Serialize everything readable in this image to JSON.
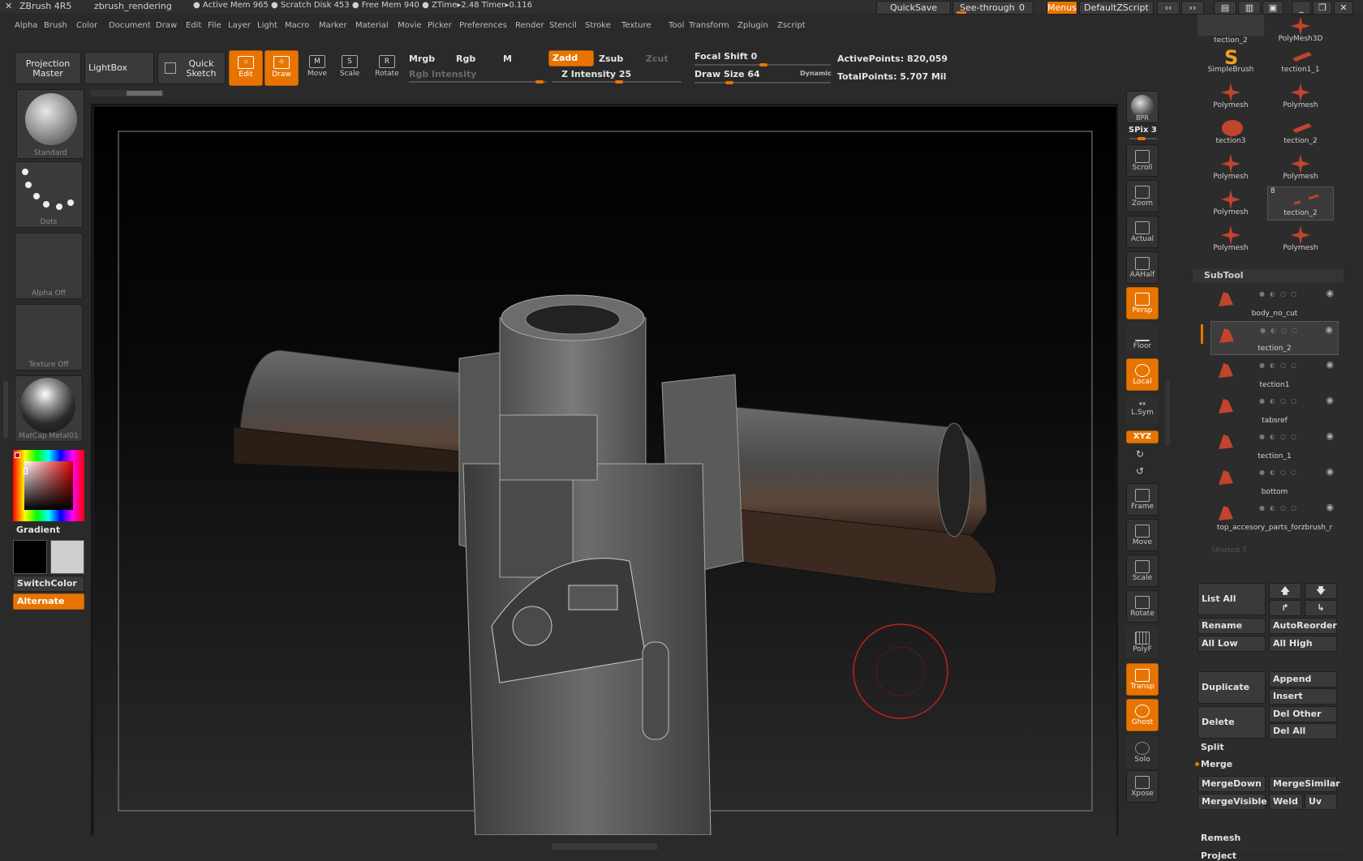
{
  "titlebar": {
    "app": "ZBrush 4R5",
    "doc": "zbrush_rendering",
    "stats": "● Active Mem 965 ● Scratch Disk 453 ● Free Mem 940 ● ZTime▸2.48 Timer▸0.116",
    "quicksave": "QuickSave",
    "seethrough": "See-through",
    "seethrough_value": "0",
    "menus": "Menus",
    "script": "DefaultZScript"
  },
  "menu": [
    "Alpha",
    "Brush",
    "Color",
    "Document",
    "Draw",
    "Edit",
    "File",
    "Layer",
    "Light",
    "Macro",
    "Marker",
    "Material",
    "Movie",
    "Picker",
    "Preferences",
    "Render",
    "Stencil",
    "Stroke",
    "Texture",
    "Tool",
    "Transform",
    "Zplugin",
    "Zscript"
  ],
  "toolbar": {
    "projection_master": "Projection Master",
    "lightbox": "LightBox",
    "quick_sketch": "Quick Sketch",
    "edit": "Edit",
    "draw": "Draw",
    "move": "Move",
    "scale": "Scale",
    "rotate": "Rotate",
    "mrgb": "Mrgb",
    "rgb": "Rgb",
    "m": "M",
    "rgb_intensity": "Rgb Intensity",
    "zadd": "Zadd",
    "zsub": "Zsub",
    "zcut": "Zcut",
    "z_intensity": "Z Intensity 25",
    "focal_shift": "Focal Shift 0",
    "draw_size": "Draw Size 64",
    "dynamic": "Dynamic",
    "active_points": "ActivePoints: 820,059",
    "total_points": "TotalPoints: 5.707 Mil"
  },
  "left": {
    "brush": "Standard",
    "stroke": "Dots",
    "alpha": "Alpha Off",
    "texture": "Texture Off",
    "material": "MatCap Metal01",
    "gradient": "Gradient",
    "switchcolor": "SwitchColor",
    "alternate": "Alternate"
  },
  "right_strip": {
    "bpr": "BPR",
    "spix": "SPix 3",
    "scroll": "Scroll",
    "zoom": "Zoom",
    "actual": "Actual",
    "aahalf": "AAHalf",
    "persp": "Persp",
    "floor": "Floor",
    "local": "Local",
    "lsym": "L.Sym",
    "xyz": "XYZ",
    "frame": "Frame",
    "move": "Move",
    "scale": "Scale",
    "rotate": "Rotate",
    "polyf": "PolyF",
    "transp": "Transp",
    "ghost": "Ghost",
    "solo": "Solo",
    "xpose": "Xpose"
  },
  "tools": [
    {
      "name": "tection_2",
      "kind": "rect"
    },
    {
      "name": "PolyMesh3D",
      "kind": "star"
    },
    {
      "name": "SimpleBrush",
      "kind": "s"
    },
    {
      "name": "tection1_1",
      "kind": "cyl"
    },
    {
      "name": "Polymesh",
      "kind": "star"
    },
    {
      "name": "Polymesh",
      "kind": "star"
    },
    {
      "name": "tection3",
      "kind": "barrel"
    },
    {
      "name": "tection_2",
      "kind": "cyl"
    },
    {
      "name": "Polymesh",
      "kind": "star"
    },
    {
      "name": "Polymesh",
      "kind": "star"
    },
    {
      "name": "Polymesh",
      "kind": "star"
    },
    {
      "name": "tection_2",
      "kind": "dash"
    },
    {
      "name": "Polymesh",
      "kind": "star"
    },
    {
      "name": "Polymesh",
      "kind": "star"
    }
  ],
  "tool_badge": "8",
  "subtool": {
    "header": "SubTool",
    "items": [
      "body_no_cut",
      "tection_2",
      "tection1",
      "tabsref",
      "tection_1",
      "bottom",
      "top_accesory_parts_forzbrush_r"
    ],
    "unused": "Unused 7",
    "list_all": "List All",
    "rename": "Rename",
    "autoreorder": "AutoReorder",
    "all_low": "All Low",
    "all_high": "All High",
    "duplicate": "Duplicate",
    "append": "Append",
    "insert": "Insert",
    "delete": "Delete",
    "del_other": "Del Other",
    "del_all": "Del All",
    "split": "Split",
    "merge": "Merge",
    "mergedown": "MergeDown",
    "mergesimilar": "MergeSimilar",
    "mergevisible": "MergeVisible",
    "weld": "Weld",
    "uv": "Uv",
    "remesh": "Remesh",
    "project": "Project"
  },
  "colors": {
    "accent": "#e87400",
    "tool_icon": "#c0442e"
  }
}
